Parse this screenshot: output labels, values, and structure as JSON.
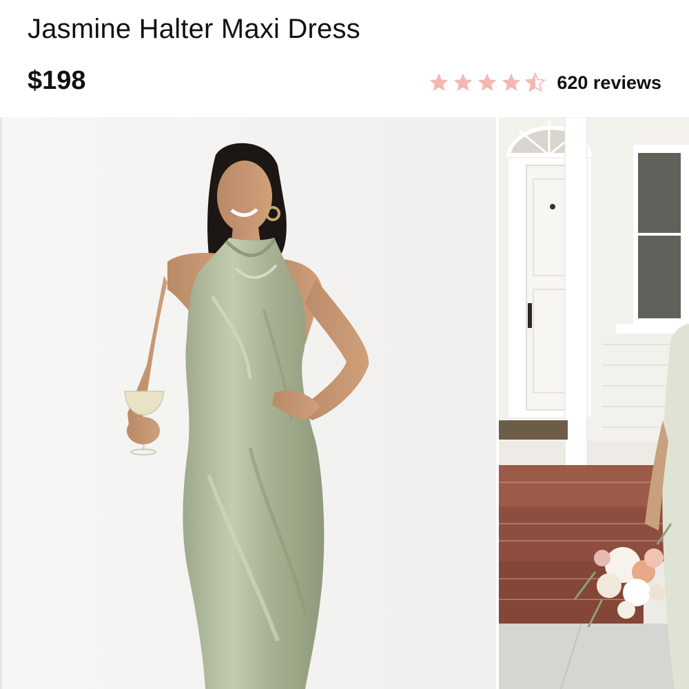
{
  "product": {
    "title": "Jasmine Halter Maxi Dress",
    "price": "$198",
    "rating": 4.5,
    "rating_max": 5,
    "reviews_label": "620 reviews"
  },
  "colors": {
    "star": "#f4b8b0",
    "dress": "#aab595",
    "background": "#ffffff"
  },
  "gallery": {
    "images": [
      {
        "icon": "model-photo"
      },
      {
        "icon": "porch-photo"
      }
    ]
  }
}
